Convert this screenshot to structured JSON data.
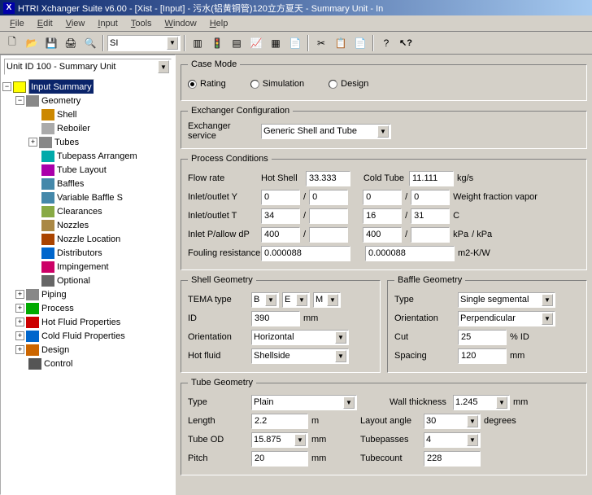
{
  "title": "HTRI Xchanger Suite v6.00 - [Xist - [Input] - 污水(铝黄铜管)120立方夏天 - Summary Unit - In",
  "menus": [
    "File",
    "Edit",
    "View",
    "Input",
    "Tools",
    "Window",
    "Help"
  ],
  "toolbar_units": "SI",
  "left_combo": "Unit ID 100 - Summary Unit",
  "tree": {
    "root": "Input Summary",
    "geometry": "Geometry",
    "items": [
      "Shell",
      "Reboiler",
      "Tubes",
      "Tubepass Arrangem",
      "Tube Layout",
      "Baffles",
      "Variable Baffle S",
      "Clearances",
      "Nozzles",
      "Nozzle Location",
      "Distributors",
      "Impingement",
      "Optional"
    ],
    "piping": "Piping",
    "process": "Process",
    "hotfluid": "Hot Fluid Properties",
    "coldfluid": "Cold Fluid Properties",
    "design": "Design",
    "control": "Control"
  },
  "casemode": {
    "legend": "Case Mode",
    "rating": "Rating",
    "simulation": "Simulation",
    "design": "Design"
  },
  "exchconf": {
    "legend": "Exchanger Configuration",
    "servicelab": "Exchanger service",
    "service": "Generic Shell and Tube"
  },
  "process": {
    "legend": "Process Conditions",
    "flowlab": "Flow rate",
    "hotshell": "Hot Shell",
    "hotval": "33.333",
    "coldtube": "Cold Tube",
    "coldval": "11.111",
    "kgs": "kg/s",
    "inouty": "Inlet/outlet Y",
    "y1": "0",
    "y2": "0",
    "y3": "0",
    "y4": "0",
    "wfv": "Weight fraction vapor",
    "inoutt": "Inlet/outlet T",
    "t1": "34",
    "t2": "",
    "t3": "16",
    "t4": "31",
    "c": "C",
    "inletp": "Inlet P/allow dP",
    "p1": "400",
    "p2": "",
    "p3": "400",
    "p4": "",
    "kpa": "kPa",
    "kpaslash": "/  kPa",
    "fouling": "Fouling resistance",
    "f1": "0.000088",
    "f2": "0.000088",
    "m2kw": "m2-K/W"
  },
  "shell": {
    "legend": "Shell Geometry",
    "tema": "TEMA type",
    "temaB": "B",
    "temaE": "E",
    "temaM": "M",
    "id": "ID",
    "idval": "390",
    "mm": "mm",
    "orient": "Orientation",
    "orientval": "Horizontal",
    "hot": "Hot fluid",
    "hotval": "Shellside"
  },
  "baffle": {
    "legend": "Baffle Geometry",
    "type": "Type",
    "typeval": "Single segmental",
    "orient": "Orientation",
    "orientval": "Perpendicular",
    "cut": "Cut",
    "cutval": "25",
    "pctid": "% ID",
    "spacing": "Spacing",
    "spacingval": "120",
    "mm": "mm"
  },
  "tube": {
    "legend": "Tube Geometry",
    "type": "Type",
    "typeval": "Plain",
    "length": "Length",
    "lengthval": "2.2",
    "m": "m",
    "od": "Tube OD",
    "odval": "15.875",
    "mm": "mm",
    "pitch": "Pitch",
    "pitchval": "20",
    "wall": "Wall thickness",
    "wallval": "1.245",
    "angle": "Layout angle",
    "angleval": "30",
    "deg": "degrees",
    "passes": "Tubepasses",
    "passval": "4",
    "count": "Tubecount",
    "countval": "228"
  }
}
